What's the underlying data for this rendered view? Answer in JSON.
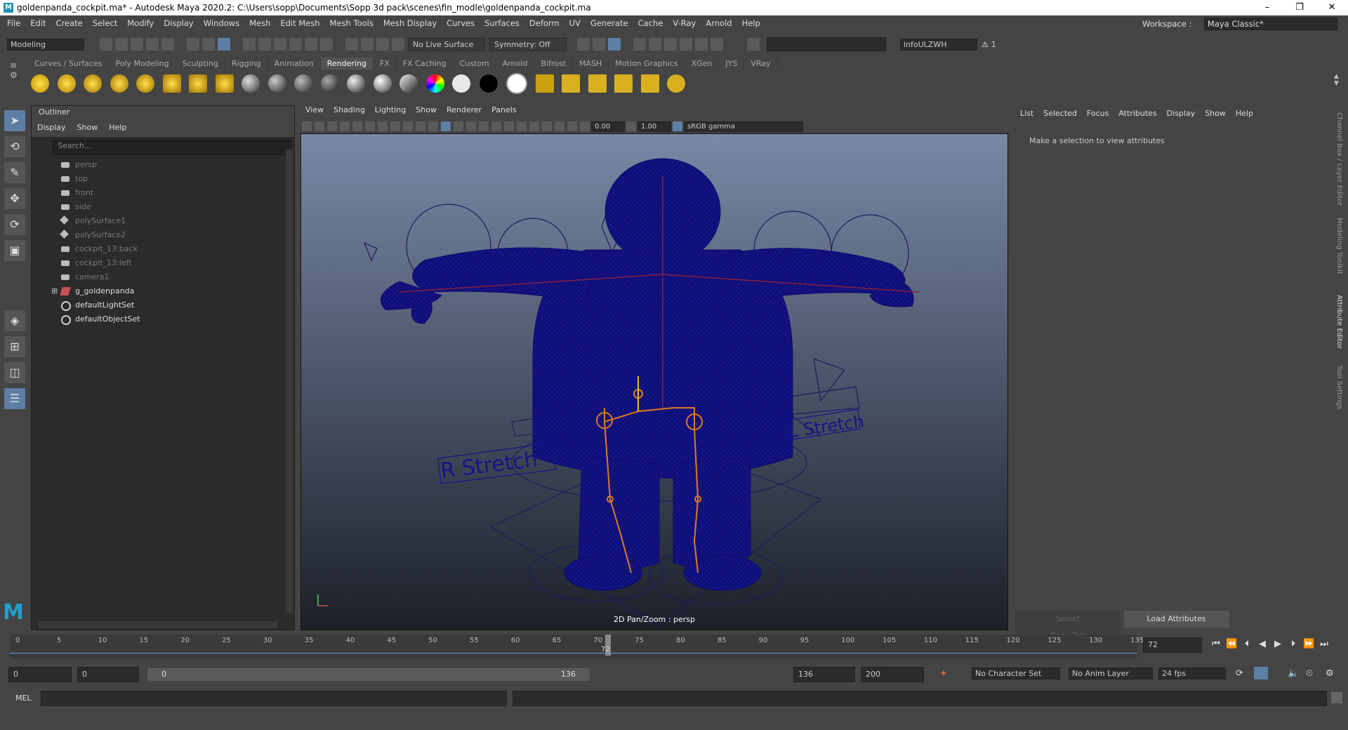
{
  "window": {
    "title": "goldenpanda_cockpit.ma* - Autodesk Maya 2020.2: C:\\Users\\sopp\\Documents\\Sopp 3d pack\\scenes\\fin_modle\\goldenpanda_cockpit.ma",
    "minimize": "–",
    "maximize": "❐",
    "close": "✕"
  },
  "menubar": {
    "items": [
      "File",
      "Edit",
      "Create",
      "Select",
      "Modify",
      "Display",
      "Windows",
      "Mesh",
      "Edit Mesh",
      "Mesh Tools",
      "Mesh Display",
      "Curves",
      "Surfaces",
      "Deform",
      "UV",
      "Generate",
      "Cache",
      "V-Ray",
      "Arnold",
      "Help"
    ],
    "workspace_label": "Workspace :",
    "workspace_value": "Maya Classic*"
  },
  "statusline": {
    "menuset": "Modeling",
    "live_surface": "No Live Surface",
    "symmetry": "Symmetry: Off",
    "user": "infoULZWH",
    "notifications": "1"
  },
  "shelf": {
    "tabs": [
      "Curves / Surfaces",
      "Poly Modeling",
      "Sculpting",
      "Rigging",
      "Animation",
      "Rendering",
      "FX",
      "FX Caching",
      "Custom",
      "Arnold",
      "Bifrost",
      "MASH",
      "Motion Graphics",
      "XGen",
      "JYS",
      "VRay"
    ],
    "active": "Rendering"
  },
  "outliner": {
    "title": "Outliner",
    "menu": [
      "Display",
      "Show",
      "Help"
    ],
    "search_placeholder": "Search...",
    "items": [
      {
        "label": "persp",
        "dim": true,
        "icon": "camera"
      },
      {
        "label": "top",
        "dim": true,
        "icon": "camera"
      },
      {
        "label": "front",
        "dim": true,
        "icon": "camera"
      },
      {
        "label": "side",
        "dim": true,
        "icon": "camera"
      },
      {
        "label": "polySurface1",
        "dim": true,
        "icon": "mesh"
      },
      {
        "label": "polySurface2",
        "dim": true,
        "icon": "mesh"
      },
      {
        "label": "cockpit_13:back",
        "dim": true,
        "icon": "camera"
      },
      {
        "label": "cockpit_13:left",
        "dim": true,
        "icon": "camera"
      },
      {
        "label": "camera1",
        "dim": true,
        "icon": "camera"
      },
      {
        "label": "g_goldenpanda",
        "dim": false,
        "icon": "group"
      },
      {
        "label": "defaultLightSet",
        "dim": false,
        "icon": "set"
      },
      {
        "label": "defaultObjectSet",
        "dim": false,
        "icon": "set"
      }
    ]
  },
  "viewport": {
    "menu": [
      "View",
      "Shading",
      "Lighting",
      "Show",
      "Renderer",
      "Panels"
    ],
    "exposure": "0.00",
    "gamma": "1.00",
    "colorspace": "sRGB gamma",
    "label": "2D Pan/Zoom : persp",
    "r_stretch": "R Stretch",
    "l_stretch": "L Stretch"
  },
  "attribute_editor": {
    "menu": [
      "List",
      "Selected",
      "Focus",
      "Attributes",
      "Display",
      "Show",
      "Help"
    ],
    "message": "Make a selection to view attributes",
    "buttons": [
      "Select",
      "Load Attributes",
      "Copy Tab"
    ]
  },
  "side_tabs": [
    "Channel Box / Layer Editor",
    "Modeling Toolkit",
    "Attribute Editor",
    "Tool Settings"
  ],
  "timeline": {
    "ticks": [
      "0",
      "5",
      "10",
      "15",
      "20",
      "25",
      "30",
      "35",
      "40",
      "45",
      "50",
      "55",
      "60",
      "65",
      "70",
      "75",
      "80",
      "85",
      "90",
      "95",
      "100",
      "105",
      "110",
      "115",
      "120",
      "125",
      "130",
      "135"
    ],
    "current_frame": "72",
    "current_field": "72"
  },
  "range": {
    "start": "0",
    "anim_start": "0",
    "slider_start": "0",
    "slider_end": "136",
    "anim_end": "136",
    "end": "200",
    "character_set": "No Character Set",
    "anim_layer": "No Anim Layer",
    "fps": "24 fps"
  },
  "command": {
    "lang": "MEL"
  },
  "colors": {
    "wire": "#0b0b6e",
    "joint": "#e07a1c",
    "accent": "#5d7fa3"
  }
}
